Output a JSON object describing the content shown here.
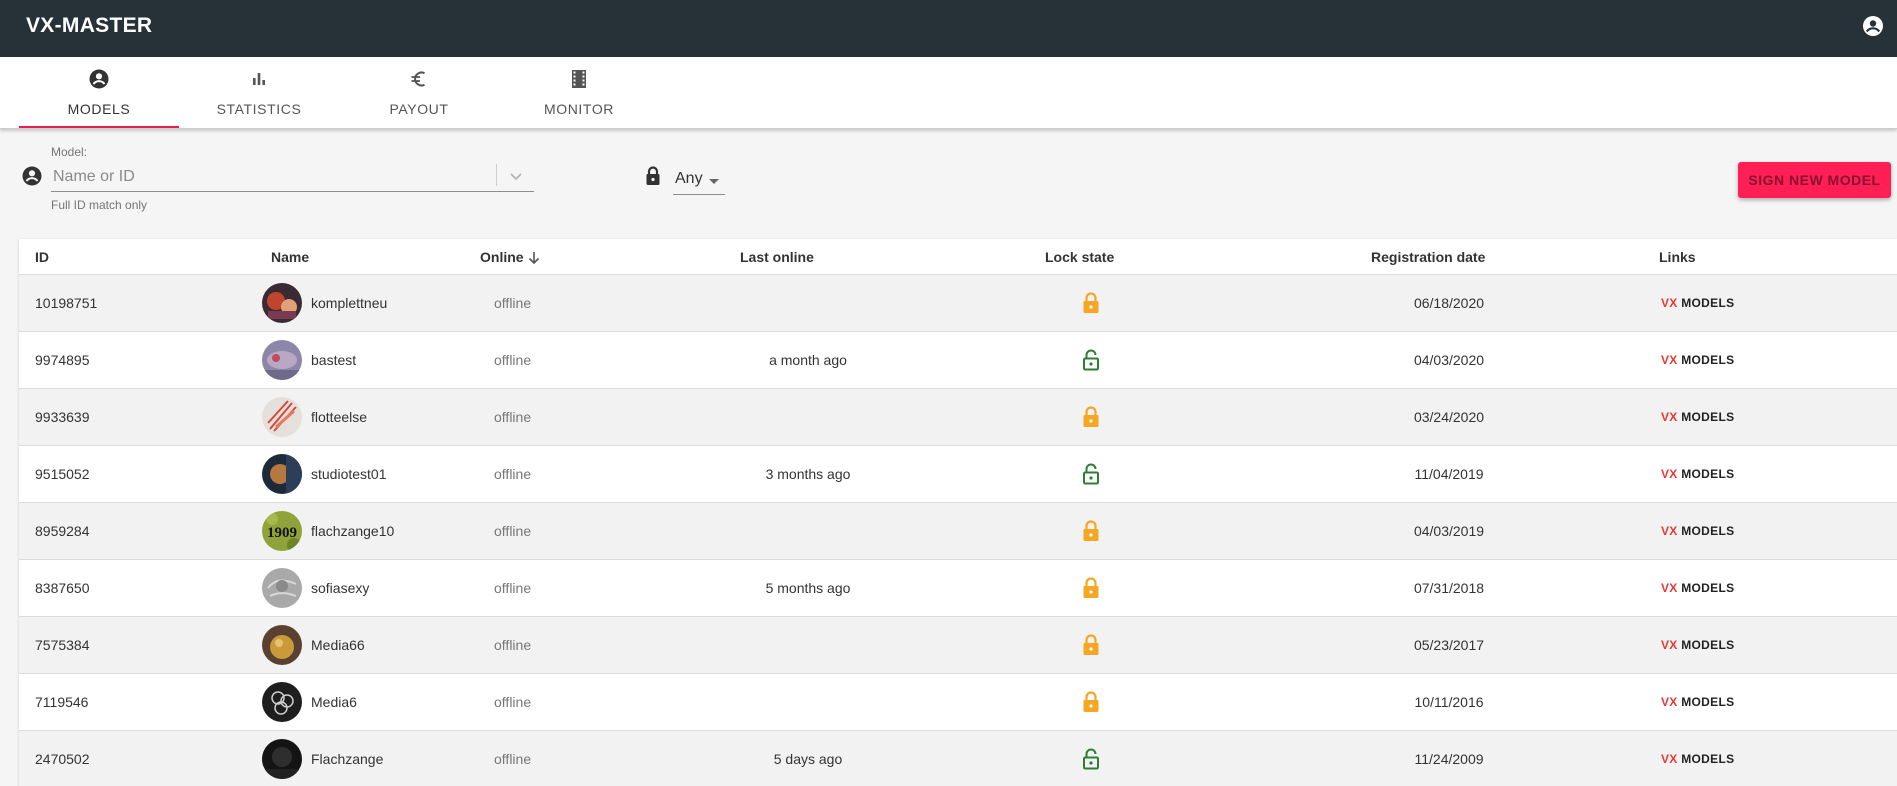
{
  "app": {
    "title": "VX-MASTER"
  },
  "tabs": [
    {
      "label": "MODELS",
      "icon": "account-circle-icon",
      "active": true
    },
    {
      "label": "STATISTICS",
      "icon": "bar-chart-icon",
      "active": false
    },
    {
      "label": "PAYOUT",
      "icon": "euro-icon",
      "active": false
    },
    {
      "label": "MONITOR",
      "icon": "film-icon",
      "active": false
    }
  ],
  "filter": {
    "model_label": "Model:",
    "model_placeholder": "Name or ID",
    "model_value": "",
    "model_hint": "Full ID match only",
    "lock_state_value": "Any",
    "sign_button": "SIGN NEW MODEL"
  },
  "table": {
    "columns": {
      "id": "ID",
      "name": "Name",
      "online": "Online",
      "last_online": "Last online",
      "lock_state": "Lock state",
      "registration_date": "Registration date",
      "links": "Links"
    },
    "link_vx": "VX",
    "link_models": "MODELS",
    "rows": [
      {
        "id": "10198751",
        "name": "komplettneu",
        "online": "offline",
        "last_online": "",
        "lock_state": "locked",
        "registration_date": "06/18/2020"
      },
      {
        "id": "9974895",
        "name": "bastest",
        "online": "offline",
        "last_online": "a month ago",
        "lock_state": "unlocked",
        "registration_date": "04/03/2020"
      },
      {
        "id": "9933639",
        "name": "flotteelse",
        "online": "offline",
        "last_online": "",
        "lock_state": "locked",
        "registration_date": "03/24/2020"
      },
      {
        "id": "9515052",
        "name": "studiotest01",
        "online": "offline",
        "last_online": "3 months ago",
        "lock_state": "unlocked",
        "registration_date": "11/04/2019"
      },
      {
        "id": "8959284",
        "name": "flachzange10",
        "online": "offline",
        "last_online": "",
        "lock_state": "locked",
        "registration_date": "04/03/2019",
        "avatar_text": "1909"
      },
      {
        "id": "8387650",
        "name": "sofiasexy",
        "online": "offline",
        "last_online": "5 months ago",
        "lock_state": "locked",
        "registration_date": "07/31/2018"
      },
      {
        "id": "7575384",
        "name": "Media66",
        "online": "offline",
        "last_online": "",
        "lock_state": "locked",
        "registration_date": "05/23/2017"
      },
      {
        "id": "7119546",
        "name": "Media6",
        "online": "offline",
        "last_online": "",
        "lock_state": "locked",
        "registration_date": "10/11/2016"
      },
      {
        "id": "2470502",
        "name": "Flachzange",
        "online": "offline",
        "last_online": "5 days ago",
        "lock_state": "unlocked",
        "registration_date": "11/24/2009"
      }
    ]
  },
  "colors": {
    "appbar": "#263238",
    "accent": "#ff1f54",
    "locked": "#f5a623",
    "unlocked": "#2e7d32"
  }
}
